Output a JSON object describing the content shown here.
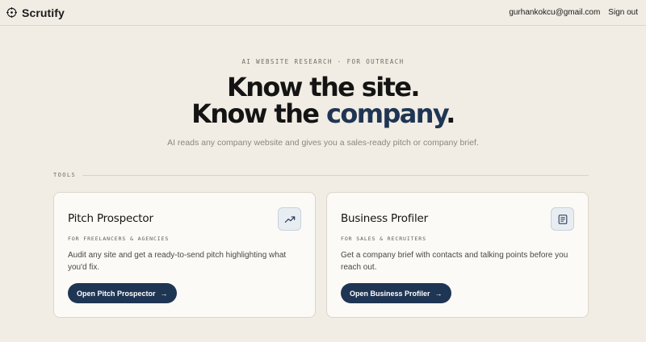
{
  "header": {
    "brand_name": "Scrutify",
    "brand_icon": "crosshair-icon",
    "user_email": "gurhankokcu@gmail.com",
    "signout_label": "Sign out"
  },
  "hero": {
    "eyebrow": "AI WEBSITE RESEARCH · FOR OUTREACH",
    "line1": "Know the site.",
    "line2_prefix": "Know the ",
    "line2_accent": "company",
    "line2_suffix": ".",
    "subtitle": "AI reads any company website and gives you a sales-ready pitch or company brief."
  },
  "tools": {
    "section_label": "TOOLS",
    "cards": [
      {
        "title": "Pitch Prospector",
        "icon": "trending-up-icon",
        "tag": "FOR FREELANCERS & AGENCIES",
        "description": "Audit any site and get a ready-to-send pitch highlighting what you'd fix.",
        "button_label": "Open Pitch Prospector"
      },
      {
        "title": "Business Profiler",
        "icon": "document-icon",
        "tag": "FOR SALES & RECRUITERS",
        "description": "Get a company brief with contacts and talking points before you reach out.",
        "button_label": "Open Business Profiler"
      }
    ]
  },
  "colors": {
    "background": "#f1ede4",
    "accent": "#1f3554",
    "card_bg": "#fbfaf6",
    "icon_bg": "#e8edf2"
  }
}
